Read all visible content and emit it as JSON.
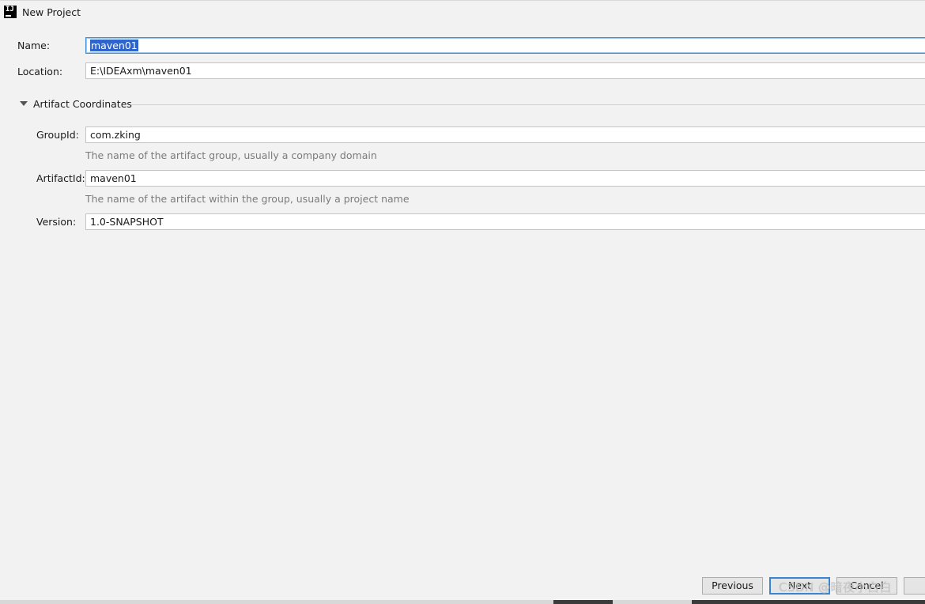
{
  "window": {
    "title": "New Project",
    "app_icon_text": "IJ",
    "app_icon": "intellij-logo-icon"
  },
  "form": {
    "name": {
      "label": "Name:",
      "value": "maven01"
    },
    "location": {
      "label": "Location:",
      "value": "E:\\IDEAxm\\maven01"
    }
  },
  "artifact": {
    "section_title": "Artifact Coordinates",
    "expand_icon": "triangle-down-icon",
    "group_id": {
      "label": "GroupId:",
      "value": "com.zking",
      "hint": "The name of the artifact group, usually a company domain"
    },
    "artifact_id": {
      "label": "ArtifactId:",
      "value": "maven01",
      "hint": "The name of the artifact within the group, usually a project name"
    },
    "version": {
      "label": "Version:",
      "value": "1.0-SNAPSHOT"
    }
  },
  "buttons": {
    "previous": "Previous",
    "next": "Next",
    "cancel": "Cancel"
  },
  "watermark": "CSDN @暗夜小白白",
  "colors": {
    "background": "#f2f2f2",
    "focus_border": "#3d8fd6",
    "selection": "#2f65ca",
    "hint_text": "#7b7b7b"
  }
}
